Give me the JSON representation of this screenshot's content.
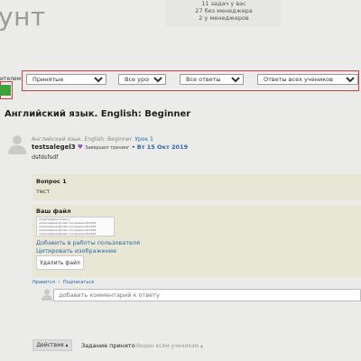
{
  "header": {
    "title": "унт",
    "stats": [
      "11 задач у вас",
      "27 без менеджера",
      "2 у менеджеров"
    ]
  },
  "filters": {
    "label": "ителем",
    "status": {
      "selected": "Принятые",
      "options": [
        "Принятые"
      ]
    },
    "lessons": {
      "selected": "Все уроки",
      "options": [
        "Все уроки"
      ]
    },
    "answers": {
      "selected": "Все ответы",
      "options": [
        "Все ответы"
      ]
    },
    "students": {
      "selected": "Ответы всех учеников",
      "options": [
        "Ответы всех учеников"
      ]
    },
    "apply_label": ""
  },
  "course": {
    "title": "Английский язык. English: Beginner"
  },
  "post": {
    "course_prefix": "Английский язык. English: Beginner.",
    "lesson_link": "Урок 1",
    "author": "testsalegel3",
    "badge_icon": "heart-icon",
    "badge_note": "Завершил тренинг",
    "bullet": "•",
    "date": "Вт 15 Окт 2019",
    "text": "dsfdsfsdf"
  },
  "question": {
    "title": "Вопрос 1",
    "answer": "тест"
  },
  "file": {
    "title": "Ваш файл",
    "thumbnail_lines": [
      "email:test@rainmail.ru",
      "name:testuser@mail.com:password12345",
      "name:testuser@mail.com:password12345",
      "name:testuser@mail.com:password12345",
      "name:testuser@mail.com:password12345"
    ],
    "add_to_works": "Добавить в работы пользователя",
    "quote_image": "Цитировать изображение",
    "delete_label": "Удалить файл"
  },
  "reactions": {
    "like": "Нравится",
    "subscribe": "Подписаться",
    "separator": "•"
  },
  "comment": {
    "placeholder": "добавить комментарий к ответу"
  },
  "footer": {
    "actions_label": "Действия ▴",
    "status": "Задание принято",
    "visibility": "Виден всем ученикам ▴"
  },
  "colors": {
    "accent_red": "#c8414a",
    "apply_green": "#3ea23c",
    "link_blue": "#2a67a8",
    "block_bg": "#e8e7d6"
  }
}
